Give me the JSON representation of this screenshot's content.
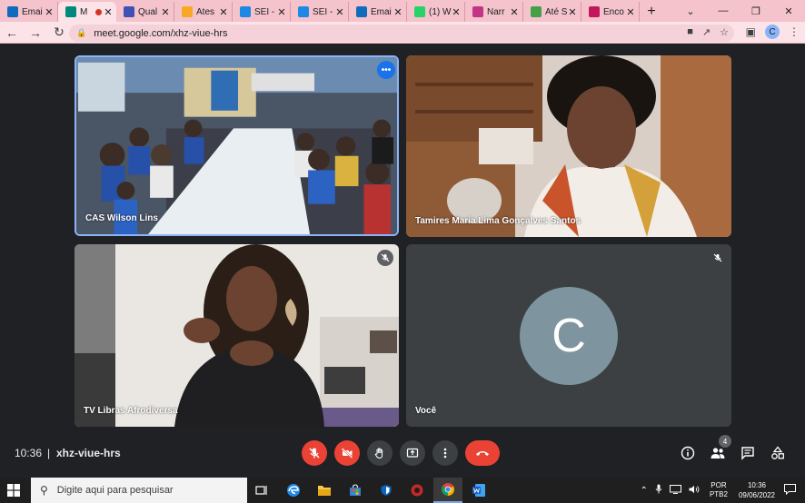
{
  "browser": {
    "tabs": [
      {
        "label": "Emai",
        "favicon": "outlook-icon",
        "color": "#0f6cbd",
        "active": false
      },
      {
        "label": "M",
        "favicon": "meet-icon",
        "color": "#00897b",
        "active": true,
        "recording": true
      },
      {
        "label": "Qual",
        "favicon": "flag-icon",
        "color": "#3f51b5",
        "active": false
      },
      {
        "label": "Ates",
        "favicon": "triangle-icon",
        "color": "#f9a825",
        "active": false
      },
      {
        "label": "SEI -",
        "favicon": "sei-icon",
        "color": "#1e88e5",
        "active": false
      },
      {
        "label": "SEI -",
        "favicon": "sei-icon",
        "color": "#1e88e5",
        "active": false
      },
      {
        "label": "Emai",
        "favicon": "outlook-icon",
        "color": "#0f6cbd",
        "active": false
      },
      {
        "label": "(1) W",
        "favicon": "whatsapp-icon",
        "color": "#25d366",
        "active": false
      },
      {
        "label": "Narr",
        "favicon": "instagram-icon",
        "color": "#c13584",
        "active": false
      },
      {
        "label": "Até S",
        "favicon": "dollar-icon",
        "color": "#43a047",
        "active": false
      },
      {
        "label": "Enco",
        "favicon": "letter-a-icon",
        "color": "#c2185b",
        "active": false
      }
    ],
    "url": "meet.google.com/xhz-viue-hrs",
    "profile_initial": "C"
  },
  "meeting": {
    "participants": [
      {
        "name": "CAS Wilson Lins",
        "muted": false
      },
      {
        "name": "Tamires Maria Lima Gonçalves Santos",
        "muted": false
      },
      {
        "name": "TV Libras Afrodiversa",
        "muted": true
      },
      {
        "name": "Você",
        "muted": true,
        "avatar_initial": "C"
      }
    ],
    "time": "10:36",
    "separator": "|",
    "code": "xhz-viue-hrs",
    "participant_count": "4"
  },
  "taskbar": {
    "search_placeholder": "Digite aqui para pesquisar",
    "lang_line1": "POR",
    "lang_line2": "PTB2",
    "time": "10:36",
    "date": "09/06/2022"
  },
  "colors": {
    "accent": "#1a73e8",
    "danger": "#ea4335",
    "tile_bg": "#3c4043",
    "avatar": "#7e959f"
  }
}
